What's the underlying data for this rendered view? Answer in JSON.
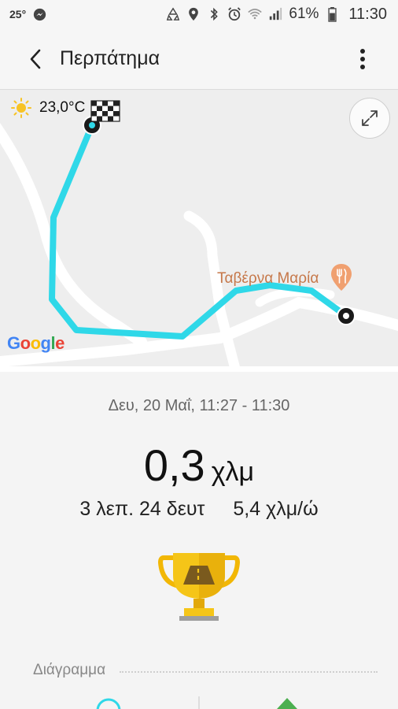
{
  "status_bar": {
    "temperature": "25°",
    "battery_percent": "61%",
    "time": "11:30",
    "icons": [
      "messenger-icon",
      "recycle-icon",
      "location-icon",
      "bluetooth-icon",
      "alarm-icon",
      "wifi-icon",
      "signal-icon",
      "battery-icon"
    ]
  },
  "app_bar": {
    "title": "Περπάτημα",
    "back_icon": "chevron-left-icon",
    "menu_icon": "more-vertical-icon"
  },
  "map": {
    "weather_icon": "sun-icon",
    "weather_temperature": "23,0°C",
    "poi_label": "Ταβέρνα Μαρία",
    "poi_icon": "restaurant-pin-icon",
    "provider_logo": "Google",
    "route_color": "#2fd8e8",
    "start_icon": "finish-flag-icon",
    "end_icon": "route-end-icon",
    "expand_icon": "expand-icon"
  },
  "workout": {
    "date_range": "Δευ, 20 Μαΐ, 11:27 - 11:30",
    "distance_value": "0,3",
    "distance_unit": "χλμ",
    "duration": "3 λεπ. 24 δευτ",
    "speed": "5,4 χλμ/ώ",
    "trophy_icon": "trophy-icon"
  },
  "sections": {
    "chart_title": "Διάγραμμα"
  }
}
